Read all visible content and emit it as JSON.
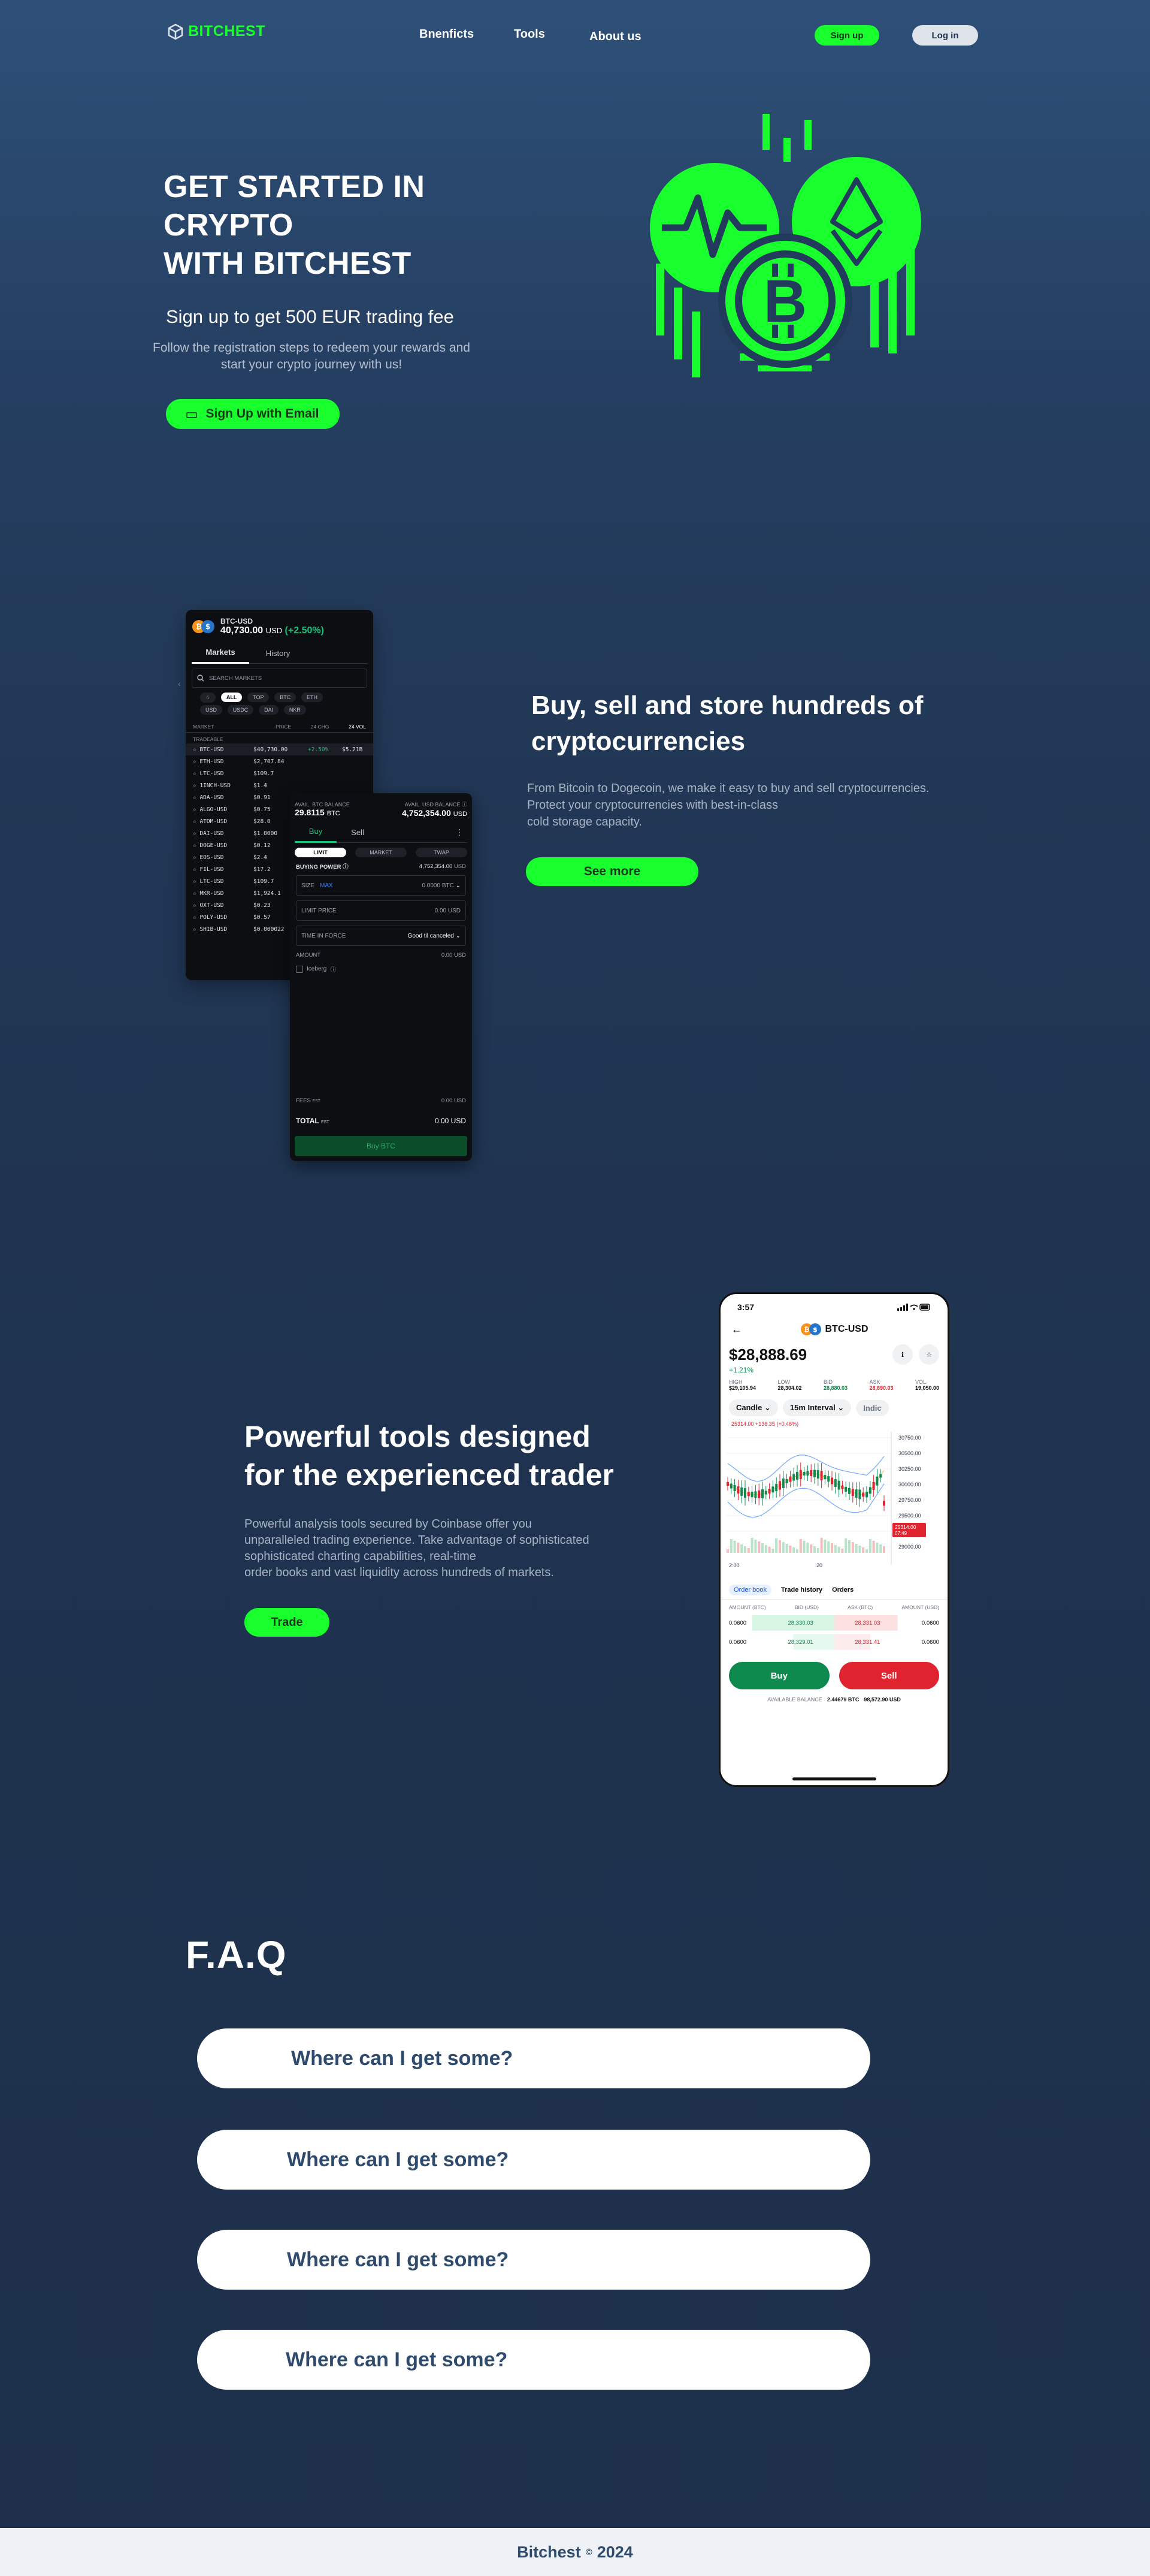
{
  "nav": {
    "logo": "BITCHEST",
    "links": [
      "Bnenficts",
      "Tools",
      "About us"
    ],
    "signup": "Sign up",
    "login": "Log in"
  },
  "hero": {
    "title_lines": [
      "GET STARTED IN",
      "CRYPTO",
      "WITH BITCHEST"
    ],
    "subtitle": "Sign up to get 500 EUR trading fee",
    "description": "Follow the registration steps to redeem your rewards and start your crypto journey with us!",
    "cta": "Sign Up with Email"
  },
  "feature1": {
    "title": "Buy, sell and store hundreds of cryptocurrencies",
    "description": "From Bitcoin to Dogecoin, we make it easy to buy and sell cryptocurrencies.\nProtect your cryptocurrencies with best-in-class\n cold storage capacity.",
    "cta": "See more",
    "markets_phone": {
      "pair": "BTC-USD",
      "price": "40,730.00",
      "currency": "USD",
      "change": "(+2.50%)",
      "tabs": [
        "Markets",
        "History"
      ],
      "search_placeholder": "SEARCH MARKETS",
      "filters_row1": [
        "☆",
        "ALL",
        "TOP",
        "BTC",
        "ETH"
      ],
      "filters_row2": [
        "USD",
        "USDC",
        "DAI",
        "NKR"
      ],
      "columns": [
        "MARKET",
        "PRICE",
        "24 CHG",
        "24 VOL"
      ],
      "section": "TRADEABLE",
      "rows": [
        [
          "BTC-USD",
          "$40,730.00",
          "+2.50%",
          "$5.21B"
        ],
        [
          "ETH-USD",
          "$2,707.84",
          "",
          ""
        ],
        [
          "LTC-USD",
          "$109.7",
          "",
          ""
        ],
        [
          "1INCH-USD",
          "$1.4",
          "",
          ""
        ],
        [
          "ADA-USD",
          "$0.91",
          "",
          ""
        ],
        [
          "ALGO-USD",
          "$0.75",
          "",
          ""
        ],
        [
          "ATOM-USD",
          "$28.0",
          "",
          ""
        ],
        [
          "DAI-USD",
          "$1.0000",
          "",
          ""
        ],
        [
          "DOGE-USD",
          "$0.12",
          "",
          ""
        ],
        [
          "EOS-USD",
          "$2.4",
          "",
          ""
        ],
        [
          "FIL-USD",
          "$17.2",
          "",
          ""
        ],
        [
          "LTC-USD",
          "$109.7",
          "",
          ""
        ],
        [
          "MKR-USD",
          "$1,924.1",
          "",
          ""
        ],
        [
          "OXT-USD",
          "$0.23",
          "",
          ""
        ],
        [
          "POLY-USD",
          "$0.57",
          "",
          ""
        ],
        [
          "SHIB-USD",
          "$0.000022",
          "",
          ""
        ]
      ]
    },
    "trade_phone": {
      "avail_btc_label": "AVAIL. BTC BALANCE",
      "avail_btc_value": "29.8115",
      "avail_btc_unit": "BTC",
      "avail_usd_label": "AVAIL. USD BALANCE",
      "avail_usd_value": "4,752,354.00",
      "avail_usd_unit": "USD",
      "tabs": [
        "Buy",
        "Sell"
      ],
      "order_types": [
        "LIMIT",
        "MARKET",
        "TWAP"
      ],
      "buying_power_label": "BUYING POWER",
      "buying_power_value": "4,752,354.00",
      "buying_power_unit": "USD",
      "size_label": "SIZE",
      "size_max": "MAX",
      "size_value": "0.0000 BTC",
      "limit_label": "LIMIT PRICE",
      "limit_value": "0.00 USD",
      "tif_label": "TIME IN FORCE",
      "tif_value": "Good til canceled",
      "amount_label": "AMOUNT",
      "amount_value": "0.00 USD",
      "iceberg": "Iceberg",
      "fees_label": "FEES",
      "fees_est": "EST",
      "fees_value": "0.00 USD",
      "total_label": "TOTAL",
      "total_est": "EST",
      "total_value": "0.00 USD",
      "buy_button": "Buy BTC"
    }
  },
  "feature2": {
    "title": "Powerful tools designed\n for the experienced trader",
    "description": "Powerful analysis tools secured by Coinbase offer you\n unparalleled trading experience. Take advantage of sophisticated\n sophisticated charting capabilities, real-time\n order books and vast liquidity across hundreds of markets.",
    "cta": "Trade",
    "phone": {
      "time": "3:57",
      "pair": "BTC-USD",
      "price": "$28,888.69",
      "change": "+1.21%",
      "stats": [
        {
          "label": "HIGH",
          "value": "$29,105.94"
        },
        {
          "label": "LOW",
          "value": "28,304.02"
        },
        {
          "label": "BID",
          "value": "28,880.03"
        },
        {
          "label": "ASK",
          "value": "28,890.03"
        },
        {
          "label": "VOL",
          "value": "19,050.00"
        }
      ],
      "chips": [
        "Candle",
        "15m Interval",
        "Indic"
      ],
      "chart_note": "25314.00 +136.35 (+0.46%)",
      "y_ticks": [
        "30750.00",
        "30500.00",
        "30250.00",
        "30000.00",
        "29750.00",
        "29500.00",
        "29250.00",
        "29000.00"
      ],
      "x_ticks": [
        "2:00",
        "20"
      ],
      "last_price_tag": "25314.00",
      "last_price_time": "07:49",
      "tabs": [
        "Order book",
        "Trade history",
        "Orders"
      ],
      "ob_columns": [
        "AMOUNT (BTC)",
        "BID (USD)",
        "ASK (BTC)",
        "AMOUNT (USD)"
      ],
      "ob_rows": [
        [
          "0.0600",
          "28,330.03",
          "28,331.03",
          "0.0600"
        ],
        [
          "0.0600",
          "28,329.01",
          "28,331.41",
          "0.0600"
        ]
      ],
      "buy": "Buy",
      "sell": "Sell",
      "balance_label": "AVAILABLE BALANCE",
      "balance_btc": "2.44679 BTC",
      "balance_usd": "98,572.90 USD"
    }
  },
  "faq": {
    "title": "F.A.Q",
    "items": [
      "Where can I get some?",
      "Where can I get some?",
      "Where can I get some?",
      "Where can I get some?"
    ]
  },
  "footer": {
    "brand": "Bitchest",
    "copyright": "©",
    "year": "2024"
  },
  "colors": {
    "accent": "#19ff2e",
    "bg_top": "#2e5078",
    "bg_bottom": "#1d2f4a",
    "faq_text": "#2e4a6d",
    "buy_green": "#0e8a4e",
    "sell_red": "#e0242f"
  }
}
